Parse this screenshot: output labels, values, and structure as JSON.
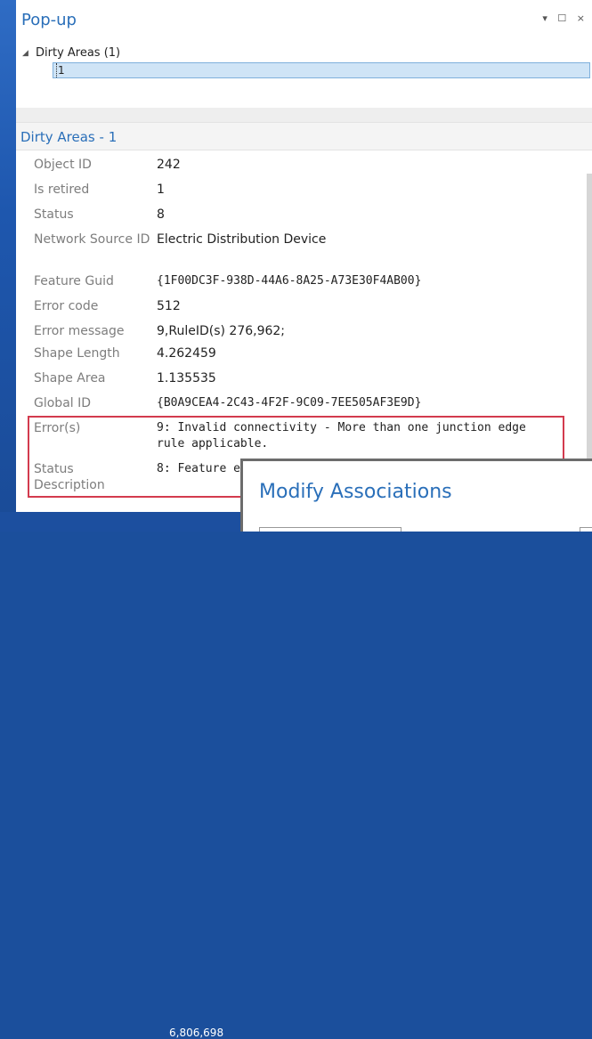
{
  "pane": {
    "title": "Pop-up",
    "controls": "▾ ☐ ×"
  },
  "tree": {
    "toggle_icon": "◢",
    "label": "Dirty Areas  (1)",
    "child": "1"
  },
  "section": {
    "title": "Dirty Areas - 1"
  },
  "attributes": [
    {
      "name": "Object ID",
      "value": "242"
    },
    {
      "name": "Is retired",
      "value": "1"
    },
    {
      "name": "Status",
      "value": "8"
    },
    {
      "name": "Network Source ID",
      "value": "Electric Distribution Device"
    },
    {
      "name": "Feature Guid",
      "value": "{1F00DC3F-938D-44A6-8A25-A73E30F4AB00}"
    },
    {
      "name": "Error code",
      "value": "512"
    },
    {
      "name": "Error message",
      "value": "9,RuleID(s) 276,962;"
    },
    {
      "name": "Shape Length",
      "value": "4.262459"
    },
    {
      "name": "Shape Area",
      "value": "1.135535"
    },
    {
      "name": "Global ID",
      "value": "{B0A9CEA4-2C43-4F2F-9C09-7EE505AF3E9D}"
    },
    {
      "name": "Error(s)",
      "value": "9: Invalid connectivity - More than one junction edge rule applicable."
    },
    {
      "name": "Status Description",
      "value": "8: Feature e"
    }
  ],
  "status_bar": {
    "number": "6,806,698"
  },
  "dialog": {
    "title": "Modify Associations"
  },
  "colors": {
    "accent": "#2a6fb9",
    "highlight": "#d33b4e",
    "background_blue": "#1b4f9c"
  }
}
